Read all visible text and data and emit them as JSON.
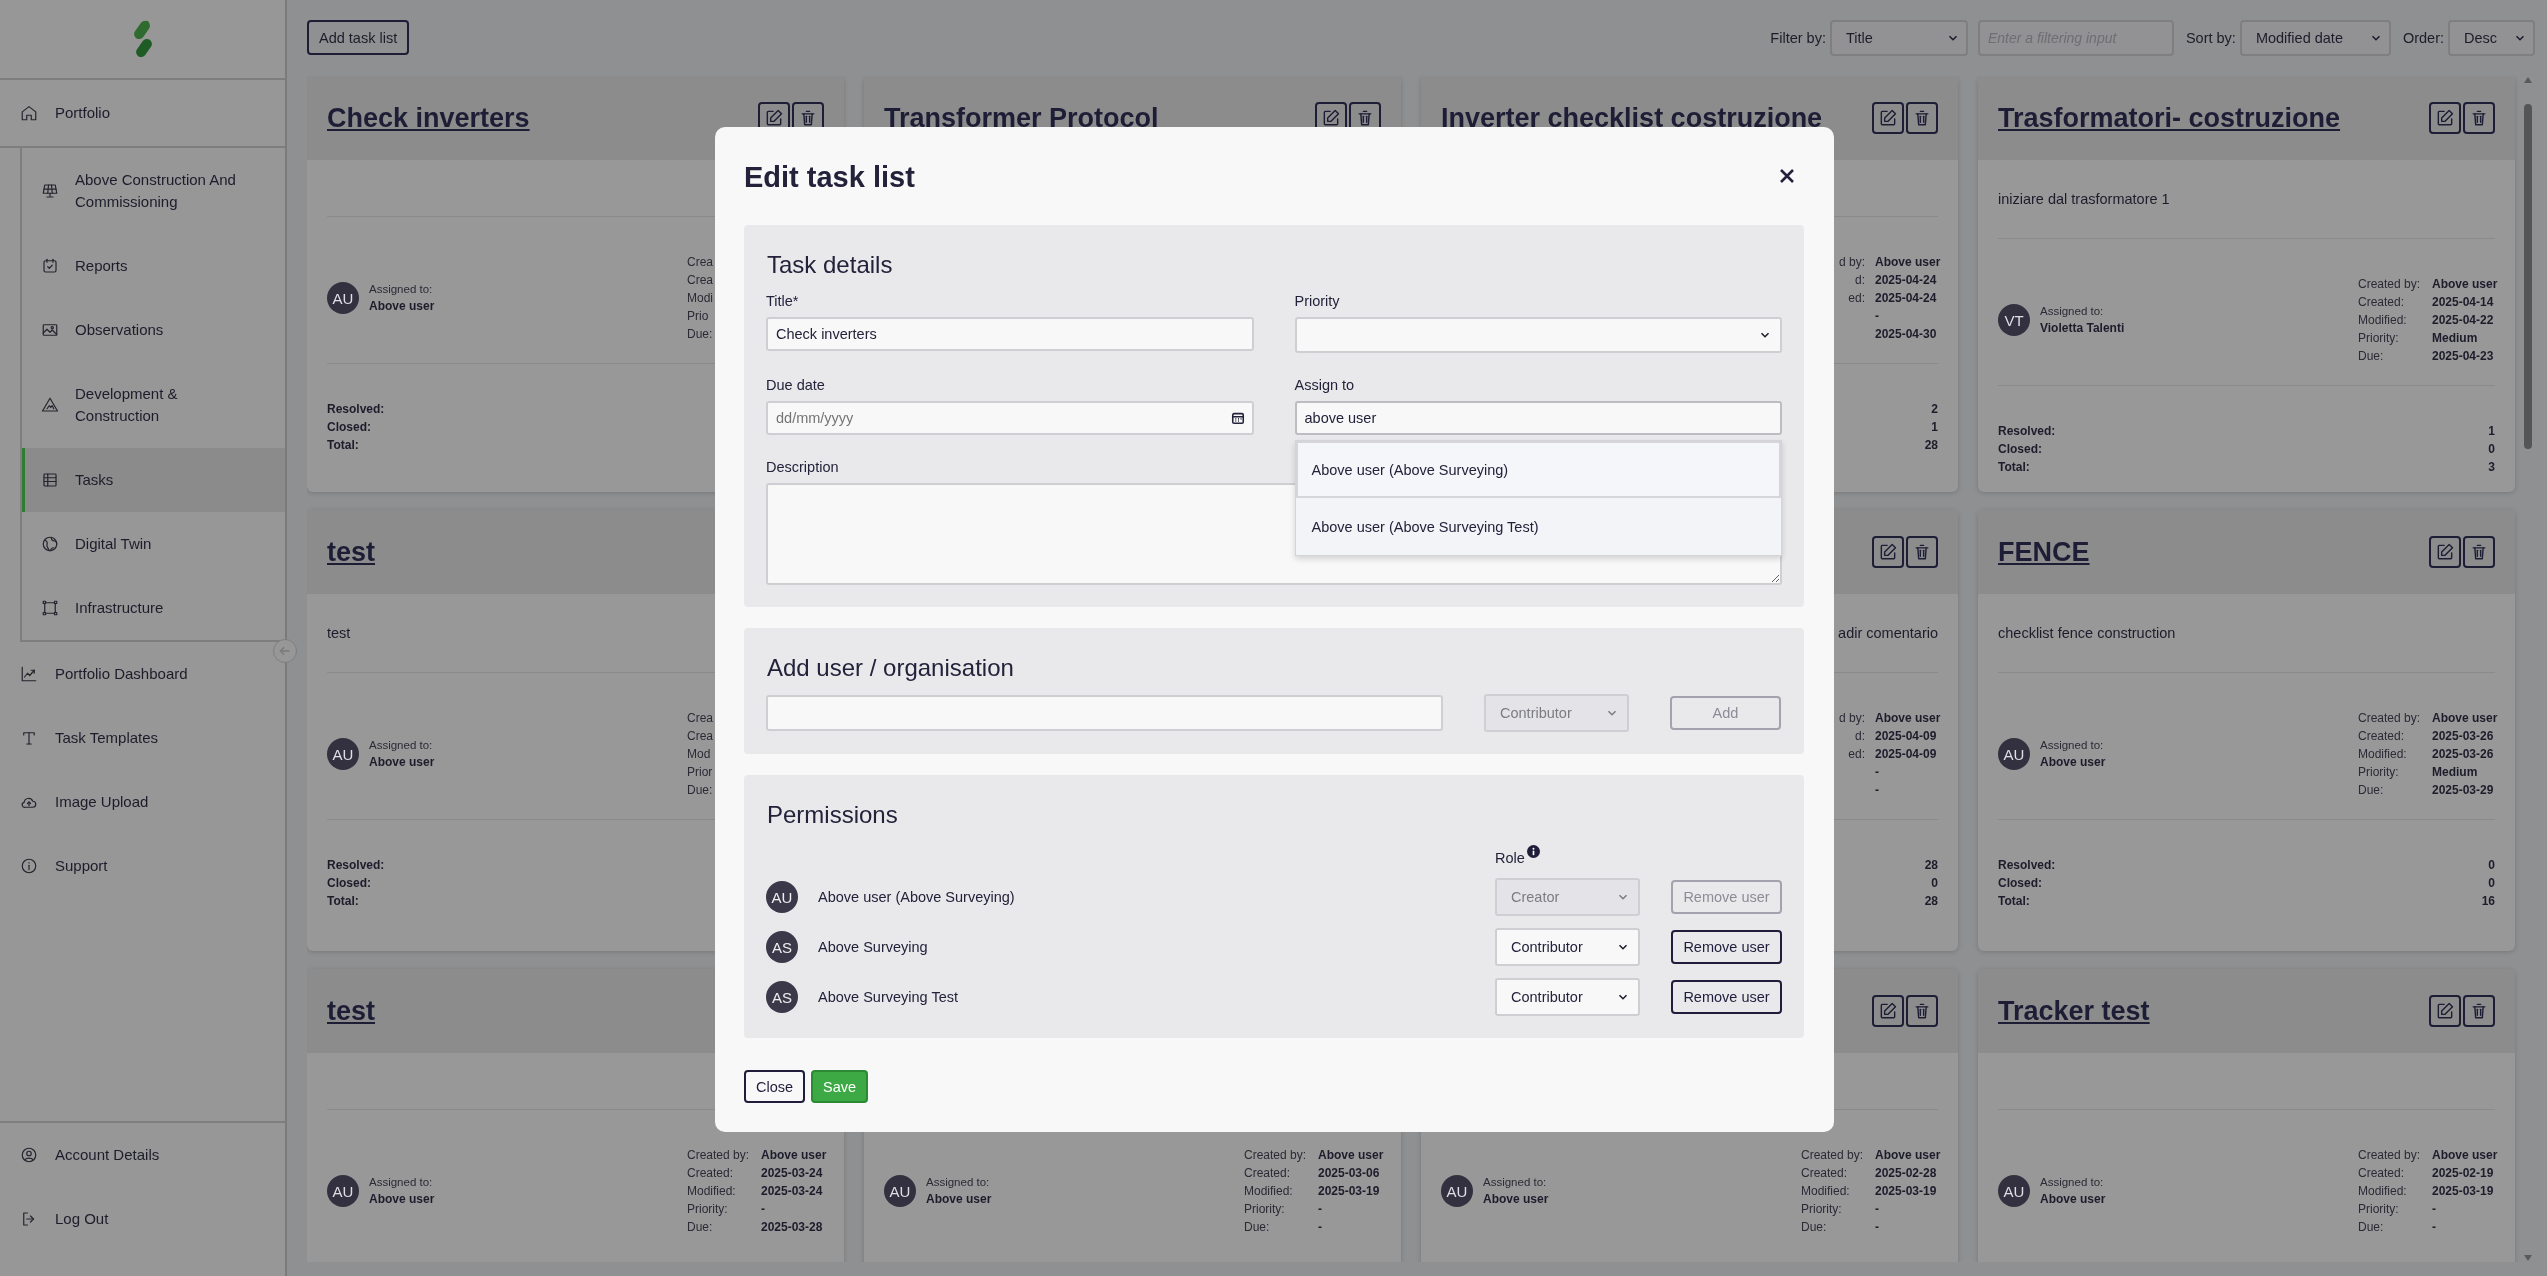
{
  "sidebar": {
    "nav": [
      {
        "label": "Portfolio",
        "selected": false,
        "expanded": true,
        "children": [
          {
            "label": "Above Construction And Commissioning",
            "selected": false
          },
          {
            "label": "Reports",
            "selected": false
          },
          {
            "label": "Observations",
            "selected": false
          },
          {
            "label": "Development & Construction",
            "selected": false
          },
          {
            "label": "Tasks",
            "selected": true
          },
          {
            "label": "Digital Twin",
            "selected": false
          },
          {
            "label": "Infrastructure",
            "selected": false
          }
        ]
      },
      {
        "label": "Portfolio Dashboard",
        "selected": false
      },
      {
        "label": "Task Templates",
        "selected": false
      },
      {
        "label": "Image Upload",
        "selected": false
      },
      {
        "label": "Support",
        "selected": false
      }
    ],
    "account": [
      {
        "label": "Account Details",
        "selected": false
      },
      {
        "label": "Log Out",
        "selected": false
      }
    ]
  },
  "toolbar": {
    "add_button": "Add task list",
    "filter_label": "Filter by:",
    "filter_value": "Title",
    "filter_placeholder": "Enter a filtering input",
    "sort_label": "Sort by:",
    "sort_value": "Modified date",
    "order_label": "Order:",
    "order_value": "Desc"
  },
  "cards": [
    {
      "title": "Check inverters",
      "assignee": {
        "initials": "AU",
        "label": "Assigned to:",
        "name": "Above user"
      },
      "meta": [
        {
          "label": "Crea"
        },
        {
          "label": "Crea"
        },
        {
          "label": "Modi"
        },
        {
          "label": "Prio"
        },
        {
          "label": "Due:"
        }
      ],
      "stats": [
        {
          "label": "Resolved:"
        },
        {
          "label": "Closed:"
        },
        {
          "label": "Total:"
        }
      ]
    },
    {
      "title": "Transformer Protocol"
    },
    {
      "title": "Inverter checklist costruzione",
      "meta": [
        {
          "label": "d by:",
          "value": "Above user"
        },
        {
          "label": "d:",
          "value": "2025-04-24"
        },
        {
          "label": "ed:",
          "value": "2025-04-24"
        },
        {
          "value": "-"
        },
        {
          "value": "2025-04-30"
        }
      ],
      "stats": [
        {
          "value": "2"
        },
        {
          "value": "1"
        },
        {
          "value": "28"
        }
      ]
    },
    {
      "title": "Trasformatori- costruzione",
      "description": "iniziare dal trasformatore 1",
      "assignee": {
        "initials": "VT",
        "label": "Assigned to:",
        "name": "Violetta Talenti"
      },
      "meta": [
        {
          "label": "Created by:",
          "value": "Above user"
        },
        {
          "label": "Created:",
          "value": "2025-04-14"
        },
        {
          "label": "Modified:",
          "value": "2025-04-22"
        },
        {
          "label": "Priority:",
          "value": "Medium"
        },
        {
          "label": "Due:",
          "value": "2025-04-23"
        }
      ],
      "stats": [
        {
          "label": "Resolved:",
          "value": "1"
        },
        {
          "label": "Closed:",
          "value": "0"
        },
        {
          "label": "Total:",
          "value": "3"
        }
      ]
    },
    {
      "title": "test",
      "description": "test",
      "assignee": {
        "initials": "AU",
        "label": "Assigned to:",
        "name": "Above user"
      },
      "meta": [
        {
          "label": "Crea"
        },
        {
          "label": "Crea"
        },
        {
          "label": "Mod"
        },
        {
          "label": "Prior"
        },
        {
          "label": "Due:"
        }
      ],
      "stats": [
        {
          "label": "Resolved:"
        },
        {
          "label": "Closed:"
        },
        {
          "label": "Total:"
        }
      ]
    },
    {
      "description": "adir comentario",
      "meta": [
        {
          "label": "d by:",
          "value": "Above user"
        },
        {
          "label": "d:",
          "value": "2025-04-09"
        },
        {
          "label": "ed:",
          "value": "2025-04-09"
        },
        {
          "value": "-"
        },
        {
          "value": "-"
        }
      ],
      "stats": [
        {
          "value": "28"
        },
        {
          "value": "0"
        },
        {
          "value": "28"
        }
      ]
    },
    {
      "title": "FENCE",
      "description": "checklist fence construction",
      "assignee": {
        "initials": "AU",
        "label": "Assigned to:",
        "name": "Above user"
      },
      "meta": [
        {
          "label": "Created by:",
          "value": "Above user"
        },
        {
          "label": "Created:",
          "value": "2025-03-26"
        },
        {
          "label": "Modified:",
          "value": "2025-03-26"
        },
        {
          "label": "Priority:",
          "value": "Medium"
        },
        {
          "label": "Due:",
          "value": "2025-03-29"
        }
      ],
      "stats": [
        {
          "label": "Resolved:",
          "value": "0"
        },
        {
          "label": "Closed:",
          "value": "0"
        },
        {
          "label": "Total:",
          "value": "16"
        }
      ]
    },
    {
      "title": "test",
      "assignee": {
        "initials": "AU",
        "label": "Assigned to:",
        "name": "Above user"
      },
      "meta": [
        {
          "label": "Created by:",
          "value": "Above user"
        },
        {
          "label": "Created:",
          "value": "2025-03-24"
        },
        {
          "label": "Modified:",
          "value": "2025-03-24"
        },
        {
          "label": "Priority:",
          "value": "-"
        },
        {
          "label": "Due:",
          "value": "2025-03-28"
        }
      ]
    },
    {
      "assignee": {
        "initials": "AU",
        "label": "Assigned to:",
        "name": "Above user"
      },
      "meta": [
        {
          "label": "Created by:",
          "value": "Above user"
        },
        {
          "label": "Created:",
          "value": "2025-03-06"
        },
        {
          "label": "Modified:",
          "value": "2025-03-19"
        },
        {
          "label": "Priority:",
          "value": "-"
        },
        {
          "label": "Due:",
          "value": "-"
        }
      ]
    },
    {
      "assignee": {
        "initials": "AU",
        "label": "Assigned to:",
        "name": "Above user"
      },
      "meta": [
        {
          "label": "Created by:",
          "value": "Above user"
        },
        {
          "label": "Created:",
          "value": "2025-02-28"
        },
        {
          "label": "Modified:",
          "value": "2025-03-19"
        },
        {
          "label": "Priority:",
          "value": "-"
        },
        {
          "label": "Due:",
          "value": "-"
        }
      ]
    },
    {
      "title": "Tracker test",
      "assignee": {
        "initials": "AU",
        "label": "Assigned to:",
        "name": "Above user"
      },
      "meta": [
        {
          "label": "Created by:",
          "value": "Above user"
        },
        {
          "label": "Created:",
          "value": "2025-02-19"
        },
        {
          "label": "Modified:",
          "value": "2025-03-19"
        },
        {
          "label": "Priority:",
          "value": "-"
        },
        {
          "label": "Due:",
          "value": "-"
        }
      ]
    }
  ],
  "modal": {
    "title": "Edit task list",
    "task_details": {
      "heading": "Task details",
      "title_label": "Title*",
      "title_value": "Check inverters",
      "priority_label": "Priority",
      "due_label": "Due date",
      "due_placeholder": "dd/mm/yyyy",
      "assign_label": "Assign to",
      "assign_value": "above user",
      "description_label": "Description",
      "suggestions": [
        {
          "label": "Above user (Above Surveying)",
          "selected": true
        },
        {
          "label": "Above user (Above Surveying Test)",
          "selected": false
        }
      ]
    },
    "add_user": {
      "heading": "Add user / organisation",
      "role": "Contributor",
      "role_disabled": true,
      "button": "Add",
      "button_disabled": true
    },
    "permissions": {
      "heading": "Permissions",
      "role_label": "Role",
      "rows": [
        {
          "initials": "AU",
          "name": "Above user (Above Surveying)",
          "role": "Creator",
          "role_disabled": true,
          "remove": "Remove user",
          "remove_disabled": true
        },
        {
          "initials": "AS",
          "name": "Above Surveying",
          "role": "Contributor",
          "role_disabled": false,
          "remove": "Remove user",
          "remove_disabled": false
        },
        {
          "initials": "AS",
          "name": "Above Surveying Test",
          "role": "Contributor",
          "role_disabled": false,
          "remove": "Remove user",
          "remove_disabled": false
        }
      ]
    },
    "buttons": [
      {
        "label": "Close",
        "kind": "secondary"
      },
      {
        "label": "Save",
        "kind": "primary"
      }
    ]
  }
}
